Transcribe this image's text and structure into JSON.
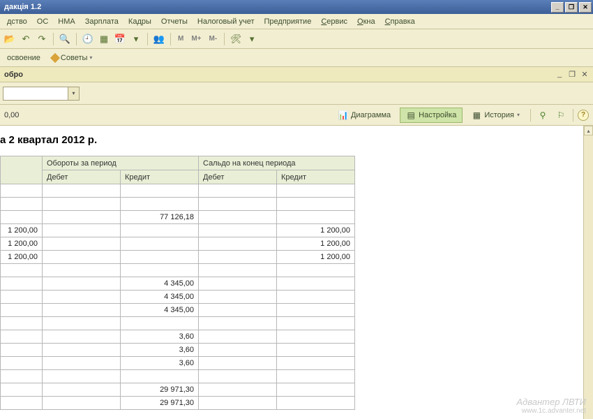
{
  "titlebar": {
    "title": "дакція 1.2"
  },
  "menu": {
    "items": [
      "дство",
      "ОС",
      "НМА",
      "Зарплата",
      "Кадры",
      "Отчеты",
      "Налоговый учет",
      "Предприятие",
      "Сервис",
      "Окна",
      "Справка"
    ],
    "underline_index": [
      -1,
      -1,
      -1,
      -1,
      -1,
      -1,
      -1,
      -1,
      0,
      0,
      0
    ]
  },
  "toolbar": {
    "m_labels": [
      "M",
      "M+",
      "M-"
    ]
  },
  "toolbar2": {
    "osvoenie": "освоение",
    "sovety": "Советы"
  },
  "docbar": {
    "title": "обро"
  },
  "action_left": "0,00",
  "action_buttons": {
    "diagram": "Диаграмма",
    "settings": "Настройка",
    "history": "История"
  },
  "report": {
    "title": "а 2 квартал 2012 р.",
    "headers": {
      "group1": "Обороты за период",
      "group2": "Сальдо на конец периода",
      "debit": "Дебет",
      "credit": "Кредит"
    },
    "rows": [
      {
        "c0": "",
        "c1": "",
        "c2": "",
        "c3": "",
        "c4": ""
      },
      {
        "c0": "",
        "c1": "",
        "c2": "",
        "c3": "",
        "c4": ""
      },
      {
        "c0": "",
        "c1": "",
        "c2": "77 126,18",
        "c3": "",
        "c4": ""
      },
      {
        "c0": "1 200,00",
        "c1": "",
        "c2": "",
        "c3": "",
        "c4": "1 200,00"
      },
      {
        "c0": "1 200,00",
        "c1": "",
        "c2": "",
        "c3": "",
        "c4": "1 200,00"
      },
      {
        "c0": "1 200,00",
        "c1": "",
        "c2": "",
        "c3": "",
        "c4": "1 200,00"
      },
      {
        "c0": "",
        "c1": "",
        "c2": "",
        "c3": "",
        "c4": ""
      },
      {
        "c0": "",
        "c1": "",
        "c2": "4 345,00",
        "c3": "",
        "c4": ""
      },
      {
        "c0": "",
        "c1": "",
        "c2": "4 345,00",
        "c3": "",
        "c4": ""
      },
      {
        "c0": "",
        "c1": "",
        "c2": "4 345,00",
        "c3": "",
        "c4": ""
      },
      {
        "c0": "",
        "c1": "",
        "c2": "",
        "c3": "",
        "c4": ""
      },
      {
        "c0": "",
        "c1": "",
        "c2": "3,60",
        "c3": "",
        "c4": ""
      },
      {
        "c0": "",
        "c1": "",
        "c2": "3,60",
        "c3": "",
        "c4": ""
      },
      {
        "c0": "",
        "c1": "",
        "c2": "3,60",
        "c3": "",
        "c4": ""
      },
      {
        "c0": "",
        "c1": "",
        "c2": "",
        "c3": "",
        "c4": ""
      },
      {
        "c0": "",
        "c1": "",
        "c2": "29 971,30",
        "c3": "",
        "c4": ""
      },
      {
        "c0": "",
        "c1": "",
        "c2": "29 971,30",
        "c3": "",
        "c4": ""
      }
    ]
  },
  "watermark": {
    "line1": "Адвантер ЛВТИ",
    "line2": "www.1c.advanter.net"
  }
}
